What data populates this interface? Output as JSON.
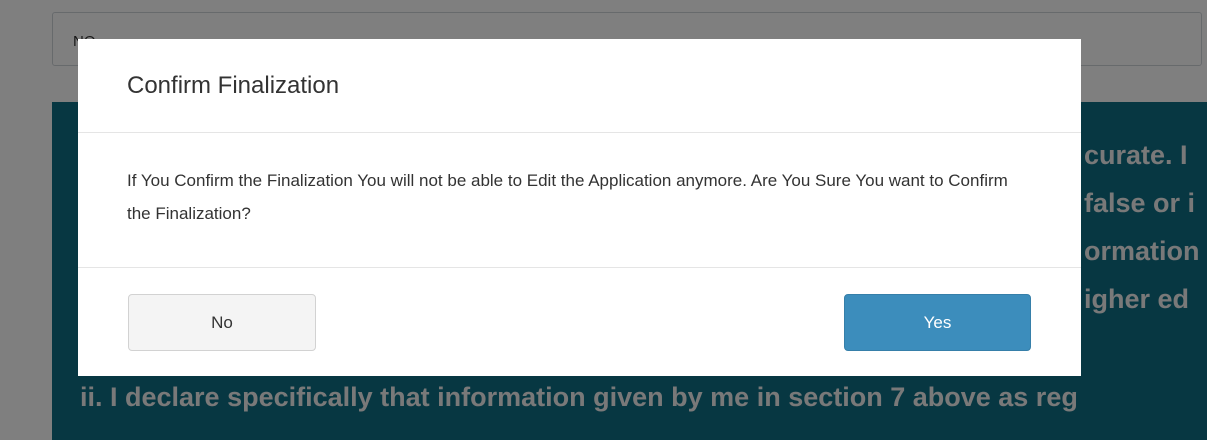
{
  "background": {
    "select_value": "NO",
    "declaration_fragments": [
      "curate. I",
      "false or i",
      "ormation",
      "igher ed"
    ],
    "declaration_line_ii": "ii. I declare specifically that information given by me in section 7 above as reg"
  },
  "modal": {
    "title": "Confirm Finalization",
    "message": "If You Confirm the Finalization You will not be able to Edit the Application anymore. Are You Sure You want to Confirm the Finalization?",
    "buttons": {
      "no_label": "No",
      "yes_label": "Yes"
    }
  },
  "colors": {
    "declaration_bg": "#0f6e85",
    "primary_button": "#3c8dbc",
    "default_button": "#f4f4f4"
  }
}
